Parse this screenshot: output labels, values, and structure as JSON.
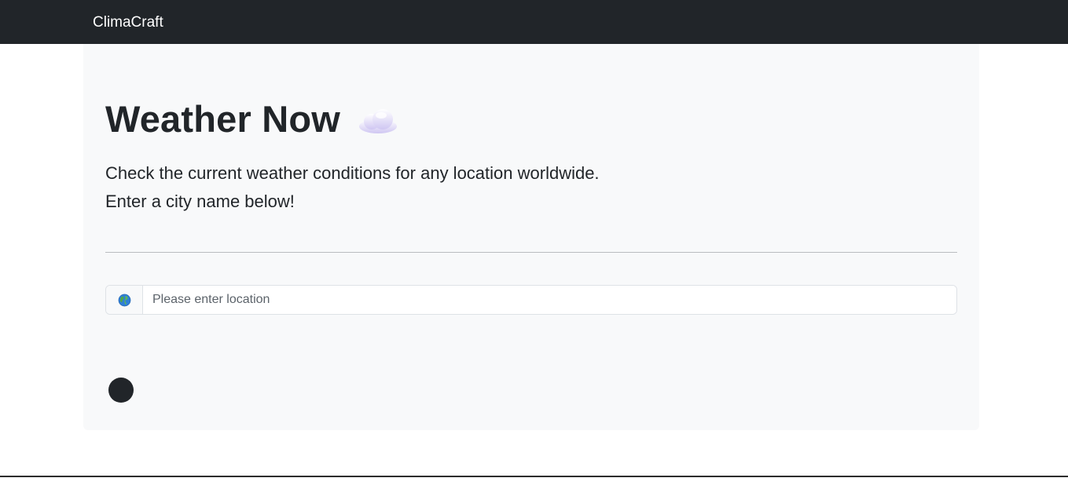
{
  "navbar": {
    "brand": "ClimaCraft"
  },
  "hero": {
    "title": "Weather Now",
    "title_icon": "cloud-icon",
    "lead_line_1": "Check the current weather conditions for any location worldwide.",
    "lead_line_2": "Enter a city name below!"
  },
  "search": {
    "addon_icon": "globe-icon",
    "placeholder": "Please enter location",
    "value": ""
  },
  "status": {
    "loading_indicator": "spinner"
  },
  "colors": {
    "navbar_bg": "#212529",
    "panel_bg": "#f8f9fa",
    "text": "#212529",
    "border": "#dee2e6"
  }
}
